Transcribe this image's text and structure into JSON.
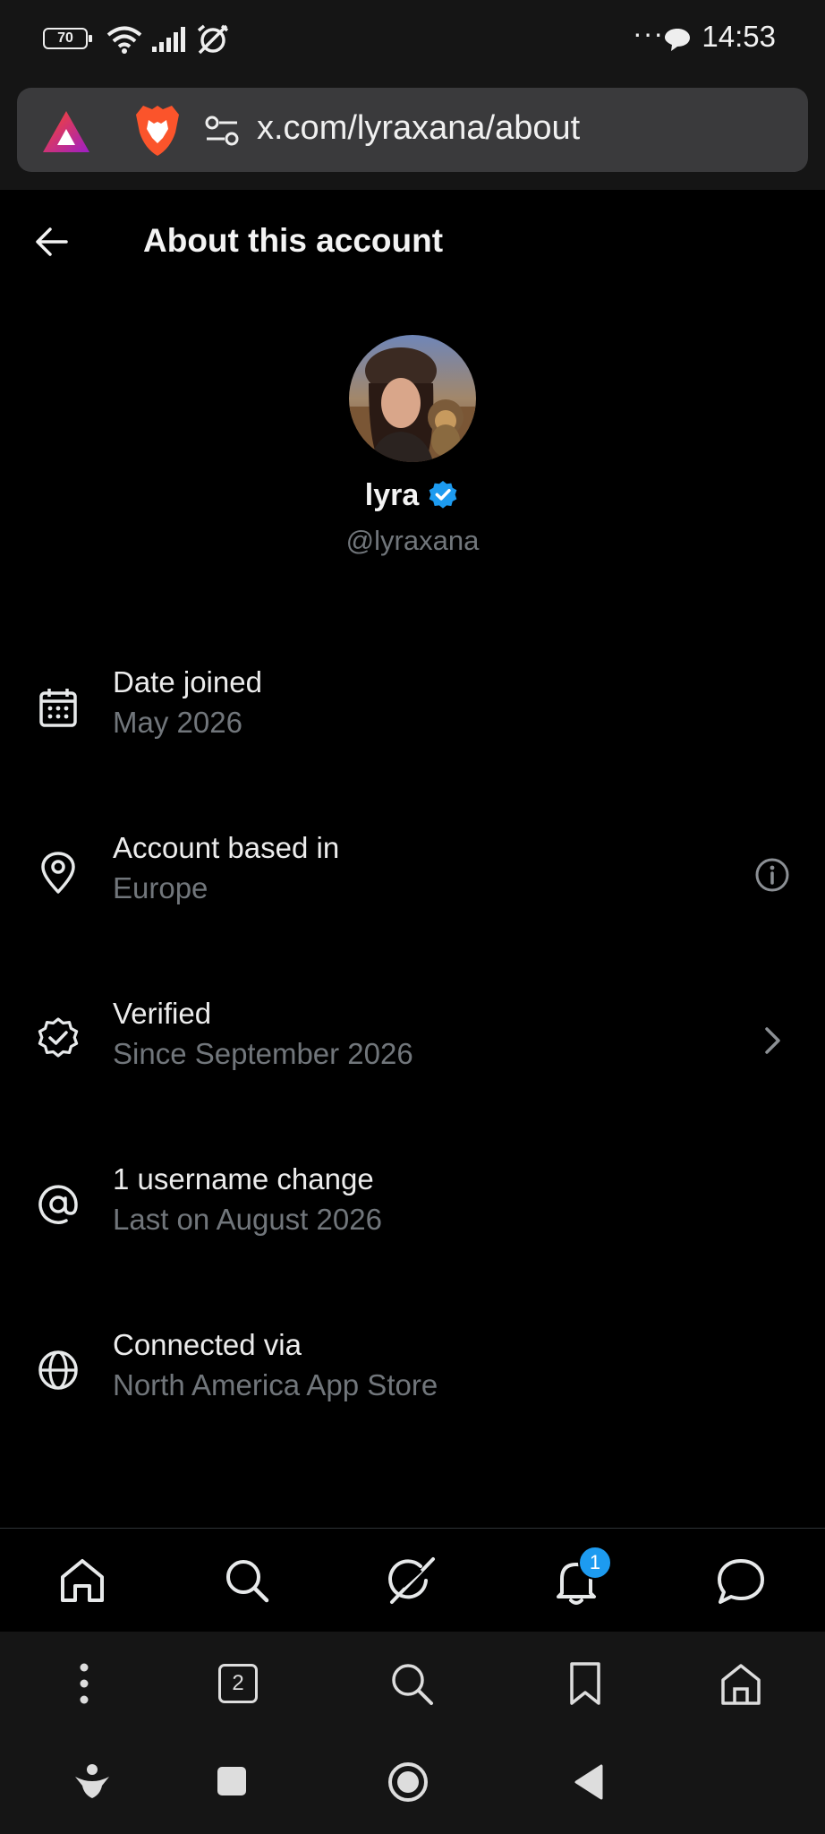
{
  "status_bar": {
    "battery": "70",
    "time": "14:53",
    "overflow": "···",
    "icons": [
      "battery-icon",
      "wifi-icon",
      "signal-icon",
      "alarm-off-icon",
      "chat-bubble-icon"
    ]
  },
  "browser": {
    "url": "x.com/lyraxana/about",
    "icons": [
      "brave-rewards-icon",
      "brave-lion-icon",
      "site-settings-icon"
    ]
  },
  "header": {
    "title": "About this account"
  },
  "profile": {
    "name": "lyra",
    "handle": "@lyraxana",
    "verified_color": "#1d9bf0"
  },
  "rows": [
    {
      "icon": "calendar-icon",
      "title": "Date joined",
      "subtitle": "May 2026"
    },
    {
      "icon": "location-pin-icon",
      "title": "Account based in",
      "subtitle": "Europe",
      "right_icon": "info-icon"
    },
    {
      "icon": "verified-badge-icon",
      "title": "Verified",
      "subtitle": "Since September 2026",
      "right_icon": "chevron-right-icon"
    },
    {
      "icon": "at-sign-icon",
      "title": "1 username change",
      "subtitle": "Last on August 2026"
    },
    {
      "icon": "globe-icon",
      "title": "Connected via",
      "subtitle": "North America App Store"
    }
  ],
  "bottom_nav": {
    "items": [
      "home-icon",
      "search-icon",
      "grok-icon",
      "notifications-icon",
      "messages-icon"
    ],
    "notification_count": "1",
    "badge_color": "#1d9bf0"
  },
  "browser_toolbar": {
    "tab_count": "2",
    "items": [
      "menu-icon",
      "tabs-icon",
      "search-icon",
      "bookmark-icon",
      "home-icon"
    ]
  },
  "android_nav": {
    "items": [
      "assistant-icon",
      "recents-icon",
      "home-icon",
      "back-icon"
    ]
  },
  "colors": {
    "background": "#000000",
    "secondary_text": "#71767b",
    "accent": "#1d9bf0"
  }
}
